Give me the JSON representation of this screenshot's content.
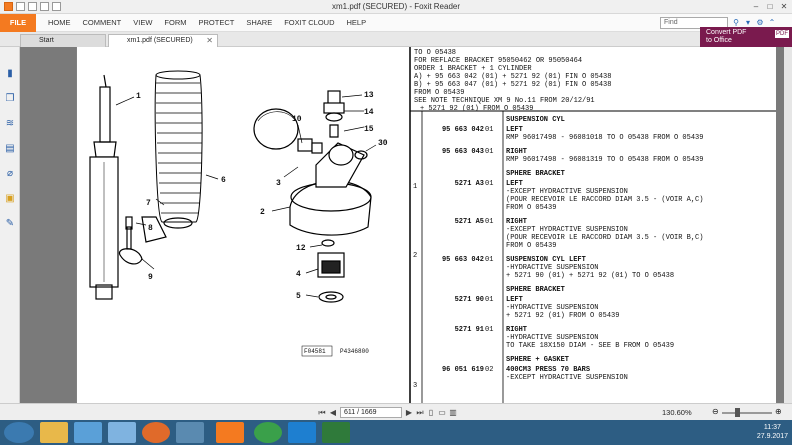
{
  "window": {
    "title": "xm1.pdf (SECURED) - Foxit Reader"
  },
  "ribbon": {
    "file_label": "FILE",
    "menu": [
      "HOME",
      "COMMENT",
      "VIEW",
      "FORM",
      "PROTECT",
      "SHARE",
      "FOXIT CLOUD",
      "HELP"
    ],
    "find_placeholder": "Find"
  },
  "tabs": {
    "start": "Start",
    "doc": "xm1.pdf (SECURED)"
  },
  "convert": {
    "line1": "Convert PDF",
    "line2": "to Office",
    "badge": "PDF"
  },
  "status": {
    "page_input": "611 / 1669",
    "zoom": "130.60%"
  },
  "clock": {
    "time": "11:37",
    "date": "27.9.2017"
  },
  "doc": {
    "header_lines": [
      "TO O 05438",
      "FOR REFLACE BRACKET 95050462 OR 95050464",
      "ORDER 1 BRACKET + 1 CYLINDER",
      "A) + 95 663 042 (01) + 5271 92 (01) FIN O 05438",
      "B) + 95 663 047 (01) + 5271 92 (01) FIN O 05438",
      "FROM O 05439",
      "SEE NOTE TECHNIQUE XM 9 No.11 FROM 20/12/91",
      "+ 5271 92 (01) FROM O 05439"
    ],
    "diagram_numbers": [
      "1",
      "6",
      "7",
      "8",
      "9",
      "2",
      "3",
      "10",
      "13",
      "14",
      "15",
      "30",
      "12",
      "4",
      "5"
    ],
    "diagram_code_left": "F04581",
    "diagram_code_right": "P4346800",
    "side_refs": [
      "1",
      "2",
      "3"
    ],
    "rows": [
      {
        "ref": "",
        "qty": "",
        "lines": [
          "SUSPENSION CYL"
        ]
      },
      {
        "ref": "95 663 042",
        "qty": "01",
        "lines": [
          "LEFT",
          "RMP 96017498 - 96081018 TO O 05438 FROM O 05439"
        ]
      },
      {
        "ref": "95 663 043",
        "qty": "01",
        "lines": [
          "RIGHT",
          "RMP 96017498 - 96081319 TO O 05438 FROM O 05439"
        ]
      },
      {
        "ref": "",
        "qty": "",
        "lines": [
          "SPHERE BRACKET"
        ]
      },
      {
        "ref": "5271 A3",
        "qty": "01",
        "lines": [
          "LEFT",
          "-EXCEPT HYDRACTIVE SUSPENSION",
          "(POUR RECEVOIR LE RACCORD DIAM 3.5 - (VOIR A,C)",
          "FROM O 05439"
        ]
      },
      {
        "ref": "5271 A5",
        "qty": "01",
        "lines": [
          "RIGHT",
          "-EXCEPT HYDRACTIVE SUSPENSION",
          "(POUR RECEVOIR LE RACCORD DIAM 3.5 - (VOIR B,C)",
          "FROM O 05439"
        ]
      },
      {
        "ref": "95 663 042",
        "qty": "01",
        "lines": [
          "SUSPENSION CYL LEFT",
          "-HYDRACTIVE SUSPENSION",
          "+ 5271 90 (01) + 5271 92 (01) TO O 05438"
        ]
      },
      {
        "ref": "",
        "qty": "",
        "lines": [
          "SPHERE BRACKET"
        ]
      },
      {
        "ref": "5271 90",
        "qty": "01",
        "lines": [
          "LEFT",
          "-HYDRACTIVE SUSPENSION",
          "+ 5271 92 (01) FROM O 05439"
        ]
      },
      {
        "ref": "5271 91",
        "qty": "01",
        "lines": [
          "RIGHT",
          "-HYDRACTIVE SUSPENSION",
          "TO TAKE 18X150 DIAM - SEE B FROM O 05439"
        ]
      },
      {
        "ref": "",
        "qty": "",
        "lines": [
          "SPHERE + GASKET"
        ]
      },
      {
        "ref": "96 051 619",
        "qty": "02",
        "lines": [
          "400CM3 PRESS 70 BARS",
          "-EXCEPT HYDRACTIVE SUSPENSION"
        ]
      }
    ]
  }
}
